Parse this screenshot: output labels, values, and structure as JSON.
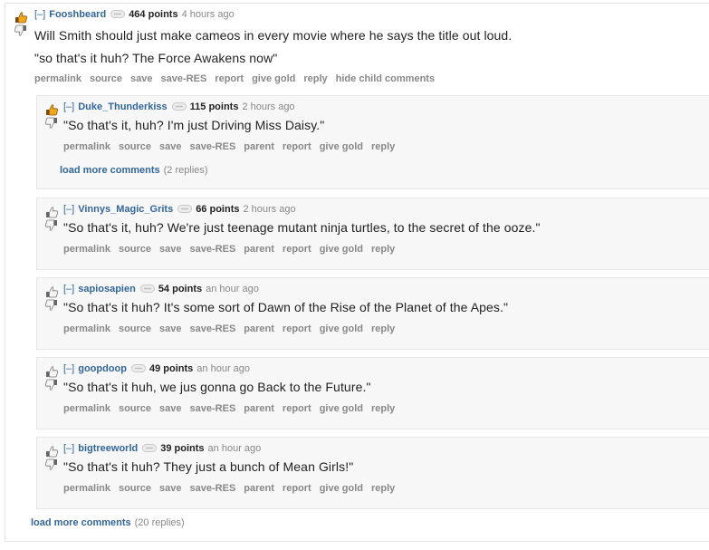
{
  "top": {
    "collapse": "[–]",
    "author": "Fooshbeard",
    "score": "464 points",
    "time": "4 hours ago",
    "body_line1": "Will Smith should just make cameos in every movie where he says the title out loud.",
    "body_line2": "\"so that's it huh? The Force Awakens now\"",
    "buttons": [
      "permalink",
      "source",
      "save",
      "save-RES",
      "report",
      "give gold",
      "reply",
      "hide child comments"
    ]
  },
  "children": [
    {
      "author": "Duke_Thunderkiss",
      "score": "115 points",
      "time": "2 hours ago",
      "body": "\"So that's it, huh? I'm just Driving Miss Daisy.\"",
      "load_more": "load more comments",
      "load_more_count": "(2 replies)"
    },
    {
      "author": "Vinnys_Magic_Grits",
      "score": "66 points",
      "time": "2 hours ago",
      "body": "\"So that's it, huh? We're just teenage mutant ninja turtles, to the secret of the ooze.\""
    },
    {
      "author": "sapiosapien",
      "score": "54 points",
      "time": "an hour ago",
      "body": "\"So that's it huh? It's some sort of Dawn of the Rise of the Planet of the Apes.\""
    },
    {
      "author": "goopdoop",
      "score": "49 points",
      "time": "an hour ago",
      "body": "\"So that's it huh, we jus gonna go Back to the Future.\""
    },
    {
      "author": "bigtreeworld",
      "score": "39 points",
      "time": "an hour ago",
      "body": "\"So that's it huh? They just a bunch of Mean Girls!\""
    }
  ],
  "child_collapse": "[–]",
  "child_buttons": [
    "permalink",
    "source",
    "save",
    "save-RES",
    "parent",
    "report",
    "give gold",
    "reply"
  ],
  "bottom": {
    "load_more": "load more comments",
    "count": "(20 replies)"
  },
  "icons": {
    "upvote_active": "thumbs-up-icon",
    "upvote": "thumbs-up-outline-icon",
    "downvote": "thumbs-down-icon",
    "tag": "user-tag-icon"
  },
  "colors": {
    "author": "#336699",
    "meta": "#888888",
    "child_bg": "#f7f7f8",
    "upvote_active": "#e08a00"
  }
}
